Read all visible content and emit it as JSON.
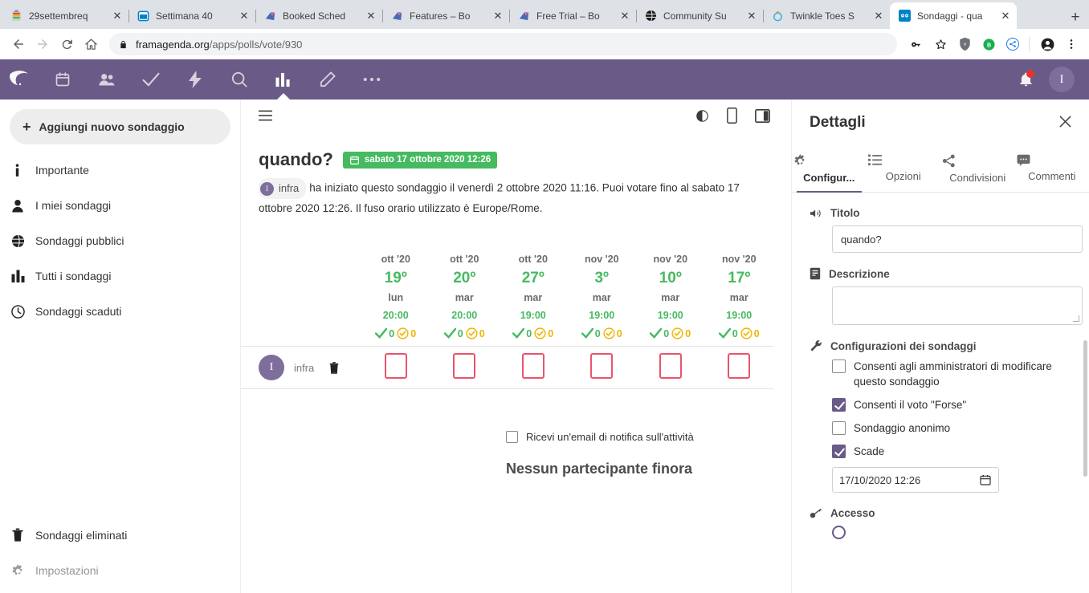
{
  "browser": {
    "tabs": [
      {
        "title": "29settembreq",
        "favicon": "clipboard-icon",
        "active": false
      },
      {
        "title": "Settimana 40",
        "favicon": "calendar-blue-icon",
        "active": false
      },
      {
        "title": "Booked Sched",
        "favicon": "booked-icon",
        "active": false
      },
      {
        "title": "Features – Bo",
        "favicon": "booked-icon",
        "active": false
      },
      {
        "title": "Free Trial – Bo",
        "favicon": "booked-icon",
        "active": false
      },
      {
        "title": "Community Su",
        "favicon": "globe-icon",
        "active": false
      },
      {
        "title": "Twinkle Toes S",
        "favicon": "twinkle-icon",
        "active": false
      },
      {
        "title": "Sondaggi - qua",
        "favicon": "polls-icon",
        "active": true
      }
    ],
    "tab_close_label": "✕",
    "new_tab_label": "+",
    "back_label": "←",
    "forward_label": "→",
    "reload_label": "↻",
    "home_label": "⌂",
    "url_host": "framagenda.org",
    "url_path": "/apps/polls/vote/930",
    "right_icons": [
      "key-icon",
      "star-icon",
      "ublock-shield-icon",
      "bitwarden-icon",
      "share-circle-icon",
      "profile-icon",
      "menu-dots-icon"
    ]
  },
  "nc_header": {
    "logo": "framagenda-logo",
    "apps": [
      {
        "name": "calendar-app-icon",
        "active": false
      },
      {
        "name": "contacts-app-icon",
        "active": false
      },
      {
        "name": "tasks-app-icon",
        "active": false
      },
      {
        "name": "activity-app-icon",
        "active": false
      },
      {
        "name": "search-app-icon",
        "active": false
      },
      {
        "name": "polls-app-icon",
        "active": true
      },
      {
        "name": "notes-app-icon",
        "active": false
      },
      {
        "name": "more-apps-icon",
        "active": false
      }
    ],
    "notifications_icon": "bell-icon",
    "avatar_initial": "I"
  },
  "sidebar": {
    "add_button": {
      "label": "Aggiungi nuovo sondaggio",
      "icon": "plus-icon"
    },
    "items": [
      {
        "label": "Importante",
        "icon": "info-icon"
      },
      {
        "label": "I miei sondaggi",
        "icon": "user-icon"
      },
      {
        "label": "Sondaggi pubblici",
        "icon": "globe-icon"
      },
      {
        "label": "Tutti i sondaggi",
        "icon": "bar-chart-icon"
      },
      {
        "label": "Sondaggi scaduti",
        "icon": "clock-icon"
      }
    ],
    "bottom_items": [
      {
        "label": "Sondaggi eliminati",
        "icon": "trash-icon",
        "muted": false
      },
      {
        "label": "Impostazioni",
        "icon": "gear-icon",
        "muted": true
      }
    ]
  },
  "main": {
    "menu_icon": "hamburger-icon",
    "toolbar_icons": [
      "contrast-icon",
      "mobile-view-icon",
      "sidebar-toggle-icon"
    ],
    "poll_title": "quando?",
    "expiry_badge": {
      "icon": "calendar-icon",
      "text": "sabato 17 ottobre 2020 12:26"
    },
    "owner_chip": {
      "initial": "I",
      "name": "infra"
    },
    "description": "ha iniziato questo sondaggio il venerdì 2 ottobre 2020 11:16. Puoi votare fino al sabato 17 ottobre 2020 12:26. Il fuso orario utilizzato è Europe/Rome.",
    "options": [
      {
        "month": "ott '20",
        "day": "19º",
        "dow": "lun",
        "time": "20:00",
        "yes": "0",
        "maybe": "0"
      },
      {
        "month": "ott '20",
        "day": "20º",
        "dow": "mar",
        "time": "20:00",
        "yes": "0",
        "maybe": "0"
      },
      {
        "month": "ott '20",
        "day": "27º",
        "dow": "mar",
        "time": "19:00",
        "yes": "0",
        "maybe": "0"
      },
      {
        "month": "nov '20",
        "day": "3º",
        "dow": "mar",
        "time": "19:00",
        "yes": "0",
        "maybe": "0"
      },
      {
        "month": "nov '20",
        "day": "10º",
        "dow": "mar",
        "time": "19:00",
        "yes": "0",
        "maybe": "0"
      },
      {
        "month": "nov '20",
        "day": "17º",
        "dow": "mar",
        "time": "19:00",
        "yes": "0",
        "maybe": "0"
      }
    ],
    "voter": {
      "initial": "I",
      "name": "infra",
      "delete_icon": "trash-icon"
    },
    "notify_label": "Ricevi un'email di notifica sull'attività",
    "notify_checked": false,
    "no_participants": "Nessun partecipante finora"
  },
  "details": {
    "title": "Dettagli",
    "close_icon": "close-icon",
    "tabs": [
      {
        "label": "Configur...",
        "icon": "gear-icon",
        "active": true
      },
      {
        "label": "Opzioni",
        "icon": "list-icon",
        "active": false
      },
      {
        "label": "Condivisioni",
        "icon": "share-icon",
        "active": false
      },
      {
        "label": "Commenti",
        "icon": "comment-icon",
        "active": false
      }
    ],
    "title_section": {
      "icon": "megaphone-icon",
      "label": "Titolo",
      "value": "quando?"
    },
    "description_section": {
      "icon": "document-icon",
      "label": "Descrizione",
      "value": ""
    },
    "config_section": {
      "icon": "wrench-icon",
      "label": "Configurazioni dei sondaggi",
      "checkboxes": [
        {
          "label": "Consenti agli amministratori di modificare questo sondaggio",
          "checked": false
        },
        {
          "label": "Consenti il voto \"Forse\"",
          "checked": true
        },
        {
          "label": "Sondaggio anonimo",
          "checked": false
        },
        {
          "label": "Scade",
          "checked": true
        }
      ],
      "expiry_value": "17/10/2020 12:26",
      "expiry_icon": "calendar-icon"
    },
    "access_section": {
      "icon": "key-icon",
      "label": "Accesso"
    }
  },
  "colors": {
    "nc_purple": "#6a5a87",
    "green": "#46ba61",
    "yellow": "#f0b400",
    "vote_red": "#e9546b"
  }
}
